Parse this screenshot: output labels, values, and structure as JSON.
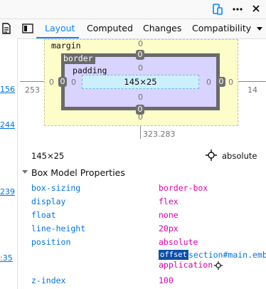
{
  "tabs": [
    {
      "label": "Layout",
      "active": true
    },
    {
      "label": "Computed"
    },
    {
      "label": "Changes"
    },
    {
      "label": "Compatibility"
    }
  ],
  "toolbar": {
    "icons": [
      "responsive-icon",
      "more-icon",
      "close-icon"
    ]
  },
  "line_links": [
    "156",
    "244",
    "239",
    ":35"
  ],
  "box_model": {
    "margin_label": "margin",
    "border_label": "border",
    "padding_label": "padding",
    "margin": {
      "top": "0",
      "right": "0",
      "bottom": "0",
      "left": "0"
    },
    "border": {
      "top": "0",
      "right": "0",
      "bottom": "0",
      "left": "0"
    },
    "padding": {
      "top": "0",
      "right": "0",
      "bottom": "0",
      "left": "0"
    },
    "content": "145×25",
    "position_left": "253",
    "position_right": "14",
    "position_bottom": "323.283"
  },
  "size_summary": "145×25",
  "position_summary": "absolute",
  "section_title": "Box Model Properties",
  "properties": [
    {
      "name": "box-sizing",
      "value": "border-box"
    },
    {
      "name": "display",
      "value": "flex"
    },
    {
      "name": "float",
      "value": "none"
    },
    {
      "name": "line-height",
      "value": "20px"
    },
    {
      "name": "position",
      "value": "absolute"
    }
  ],
  "offset_parent": {
    "badge": "offset",
    "selector": "section#main.embe",
    "selector_cont": "application"
  },
  "last_property": {
    "name": "z-index",
    "value": "100"
  },
  "colors": {
    "accent": "#0a84ff",
    "prop_name": "#0074e8",
    "prop_value": "#dd00a9"
  }
}
